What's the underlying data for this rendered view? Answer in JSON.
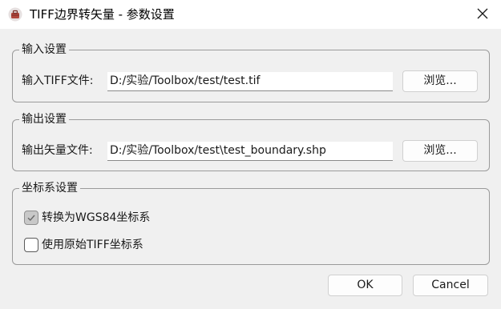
{
  "window": {
    "title": "TIFF边界转矢量 - 参数设置",
    "icon": "toolbox-icon",
    "close_icon": "close-icon"
  },
  "input_group": {
    "title": "输入设置",
    "label": "输入TIFF文件:",
    "value": "D:/实验/Toolbox/test/test.tif",
    "browse_label": "浏览..."
  },
  "output_group": {
    "title": "输出设置",
    "label": "输出矢量文件:",
    "value": "D:/实验/Toolbox/test\\test_boundary.shp",
    "browse_label": "浏览..."
  },
  "crs_group": {
    "title": "坐标系设置",
    "options": [
      {
        "label": "转换为WGS84坐标系",
        "checked": true
      },
      {
        "label": "使用原始TIFF坐标系",
        "checked": false
      }
    ]
  },
  "footer": {
    "ok_label": "OK",
    "cancel_label": "Cancel"
  },
  "colors": {
    "background": "#f0f0f0",
    "titlebar": "#ffffff",
    "group_border": "#9a9a9a",
    "checkbox_checked": "#c8c8c8"
  }
}
